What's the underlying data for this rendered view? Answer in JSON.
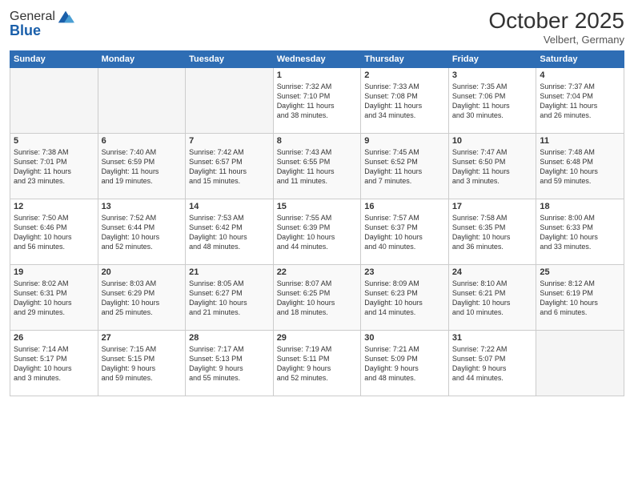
{
  "header": {
    "logo_general": "General",
    "logo_blue": "Blue",
    "month_title": "October 2025",
    "location": "Velbert, Germany"
  },
  "weekdays": [
    "Sunday",
    "Monday",
    "Tuesday",
    "Wednesday",
    "Thursday",
    "Friday",
    "Saturday"
  ],
  "weeks": [
    [
      {
        "num": "",
        "info": ""
      },
      {
        "num": "",
        "info": ""
      },
      {
        "num": "",
        "info": ""
      },
      {
        "num": "1",
        "info": "Sunrise: 7:32 AM\nSunset: 7:10 PM\nDaylight: 11 hours\nand 38 minutes."
      },
      {
        "num": "2",
        "info": "Sunrise: 7:33 AM\nSunset: 7:08 PM\nDaylight: 11 hours\nand 34 minutes."
      },
      {
        "num": "3",
        "info": "Sunrise: 7:35 AM\nSunset: 7:06 PM\nDaylight: 11 hours\nand 30 minutes."
      },
      {
        "num": "4",
        "info": "Sunrise: 7:37 AM\nSunset: 7:04 PM\nDaylight: 11 hours\nand 26 minutes."
      }
    ],
    [
      {
        "num": "5",
        "info": "Sunrise: 7:38 AM\nSunset: 7:01 PM\nDaylight: 11 hours\nand 23 minutes."
      },
      {
        "num": "6",
        "info": "Sunrise: 7:40 AM\nSunset: 6:59 PM\nDaylight: 11 hours\nand 19 minutes."
      },
      {
        "num": "7",
        "info": "Sunrise: 7:42 AM\nSunset: 6:57 PM\nDaylight: 11 hours\nand 15 minutes."
      },
      {
        "num": "8",
        "info": "Sunrise: 7:43 AM\nSunset: 6:55 PM\nDaylight: 11 hours\nand 11 minutes."
      },
      {
        "num": "9",
        "info": "Sunrise: 7:45 AM\nSunset: 6:52 PM\nDaylight: 11 hours\nand 7 minutes."
      },
      {
        "num": "10",
        "info": "Sunrise: 7:47 AM\nSunset: 6:50 PM\nDaylight: 11 hours\nand 3 minutes."
      },
      {
        "num": "11",
        "info": "Sunrise: 7:48 AM\nSunset: 6:48 PM\nDaylight: 10 hours\nand 59 minutes."
      }
    ],
    [
      {
        "num": "12",
        "info": "Sunrise: 7:50 AM\nSunset: 6:46 PM\nDaylight: 10 hours\nand 56 minutes."
      },
      {
        "num": "13",
        "info": "Sunrise: 7:52 AM\nSunset: 6:44 PM\nDaylight: 10 hours\nand 52 minutes."
      },
      {
        "num": "14",
        "info": "Sunrise: 7:53 AM\nSunset: 6:42 PM\nDaylight: 10 hours\nand 48 minutes."
      },
      {
        "num": "15",
        "info": "Sunrise: 7:55 AM\nSunset: 6:39 PM\nDaylight: 10 hours\nand 44 minutes."
      },
      {
        "num": "16",
        "info": "Sunrise: 7:57 AM\nSunset: 6:37 PM\nDaylight: 10 hours\nand 40 minutes."
      },
      {
        "num": "17",
        "info": "Sunrise: 7:58 AM\nSunset: 6:35 PM\nDaylight: 10 hours\nand 36 minutes."
      },
      {
        "num": "18",
        "info": "Sunrise: 8:00 AM\nSunset: 6:33 PM\nDaylight: 10 hours\nand 33 minutes."
      }
    ],
    [
      {
        "num": "19",
        "info": "Sunrise: 8:02 AM\nSunset: 6:31 PM\nDaylight: 10 hours\nand 29 minutes."
      },
      {
        "num": "20",
        "info": "Sunrise: 8:03 AM\nSunset: 6:29 PM\nDaylight: 10 hours\nand 25 minutes."
      },
      {
        "num": "21",
        "info": "Sunrise: 8:05 AM\nSunset: 6:27 PM\nDaylight: 10 hours\nand 21 minutes."
      },
      {
        "num": "22",
        "info": "Sunrise: 8:07 AM\nSunset: 6:25 PM\nDaylight: 10 hours\nand 18 minutes."
      },
      {
        "num": "23",
        "info": "Sunrise: 8:09 AM\nSunset: 6:23 PM\nDaylight: 10 hours\nand 14 minutes."
      },
      {
        "num": "24",
        "info": "Sunrise: 8:10 AM\nSunset: 6:21 PM\nDaylight: 10 hours\nand 10 minutes."
      },
      {
        "num": "25",
        "info": "Sunrise: 8:12 AM\nSunset: 6:19 PM\nDaylight: 10 hours\nand 6 minutes."
      }
    ],
    [
      {
        "num": "26",
        "info": "Sunrise: 7:14 AM\nSunset: 5:17 PM\nDaylight: 10 hours\nand 3 minutes."
      },
      {
        "num": "27",
        "info": "Sunrise: 7:15 AM\nSunset: 5:15 PM\nDaylight: 9 hours\nand 59 minutes."
      },
      {
        "num": "28",
        "info": "Sunrise: 7:17 AM\nSunset: 5:13 PM\nDaylight: 9 hours\nand 55 minutes."
      },
      {
        "num": "29",
        "info": "Sunrise: 7:19 AM\nSunset: 5:11 PM\nDaylight: 9 hours\nand 52 minutes."
      },
      {
        "num": "30",
        "info": "Sunrise: 7:21 AM\nSunset: 5:09 PM\nDaylight: 9 hours\nand 48 minutes."
      },
      {
        "num": "31",
        "info": "Sunrise: 7:22 AM\nSunset: 5:07 PM\nDaylight: 9 hours\nand 44 minutes."
      },
      {
        "num": "",
        "info": ""
      }
    ]
  ]
}
